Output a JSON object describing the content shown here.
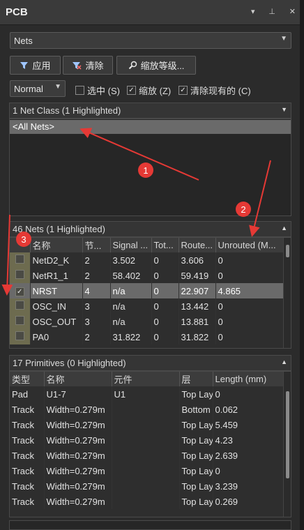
{
  "panel": {
    "title": "PCB",
    "controls": [
      "▾",
      "⊥",
      "✕"
    ]
  },
  "object_select": {
    "value": "Nets"
  },
  "toolbar": {
    "apply_label": "应用",
    "clear_label": "清除",
    "zoom_level_label": "缩放等级..."
  },
  "mode_select": {
    "value": "Normal"
  },
  "options": [
    {
      "label": "选中 (S)",
      "checked": false
    },
    {
      "label": "缩放 (Z)",
      "checked": true
    },
    {
      "label": "清除现有的 (C)",
      "checked": true
    }
  ],
  "net_classes": {
    "header": "1 Net Class (1 Highlighted)",
    "items": [
      "<All Nets>"
    ]
  },
  "nets": {
    "header": "46 Nets (1 Highlighted)",
    "columns": [
      "名称",
      "节...",
      "Signal ...",
      "Tot...",
      "Route...",
      "Unrouted (M..."
    ],
    "rows": [
      {
        "checked": false,
        "name": "NetD2_K",
        "nodes": "2",
        "signal": "3.502",
        "total": "0",
        "routed": "3.606",
        "unrouted": "0"
      },
      {
        "checked": false,
        "name": "NetR1_1",
        "nodes": "2",
        "signal": "58.402",
        "total": "0",
        "routed": "59.419",
        "unrouted": "0"
      },
      {
        "checked": true,
        "name": "NRST",
        "nodes": "4",
        "signal": "n/a",
        "total": "0",
        "routed": "22.907",
        "unrouted": "4.865"
      },
      {
        "checked": false,
        "name": "OSC_IN",
        "nodes": "3",
        "signal": "n/a",
        "total": "0",
        "routed": "13.442",
        "unrouted": "0"
      },
      {
        "checked": false,
        "name": "OSC_OUT",
        "nodes": "3",
        "signal": "n/a",
        "total": "0",
        "routed": "13.881",
        "unrouted": "0"
      },
      {
        "checked": false,
        "name": "PA0",
        "nodes": "2",
        "signal": "31.822",
        "total": "0",
        "routed": "31.822",
        "unrouted": "0"
      }
    ]
  },
  "primitives": {
    "header": "17 Primitives (0 Highlighted)",
    "columns": [
      "类型",
      "名称",
      "元件",
      "层",
      "Length (mm)"
    ],
    "rows": [
      {
        "type": "Pad",
        "name": "U1-7",
        "component": "U1",
        "layer": "Top Lay",
        "length": "0"
      },
      {
        "type": "Track",
        "name": "Width=0.279m",
        "component": "",
        "layer": "Bottom",
        "length": "0.062"
      },
      {
        "type": "Track",
        "name": "Width=0.279m",
        "component": "",
        "layer": "Top Lay",
        "length": "5.459"
      },
      {
        "type": "Track",
        "name": "Width=0.279m",
        "component": "",
        "layer": "Top Lay",
        "length": "4.23"
      },
      {
        "type": "Track",
        "name": "Width=0.279m",
        "component": "",
        "layer": "Top Lay",
        "length": "2.639"
      },
      {
        "type": "Track",
        "name": "Width=0.279m",
        "component": "",
        "layer": "Top Lay",
        "length": "0"
      },
      {
        "type": "Track",
        "name": "Width=0.279m",
        "component": "",
        "layer": "Top Lay",
        "length": "3.239"
      },
      {
        "type": "Track",
        "name": "Width=0.279m",
        "component": "",
        "layer": "Top Lay",
        "length": "0.269"
      }
    ]
  },
  "annotations": [
    "1",
    "2",
    "3"
  ],
  "colors": {
    "annotation_red": "#e53935",
    "selected_row": "#6a6a6a",
    "checkbox_column": "#6d6b4f"
  }
}
